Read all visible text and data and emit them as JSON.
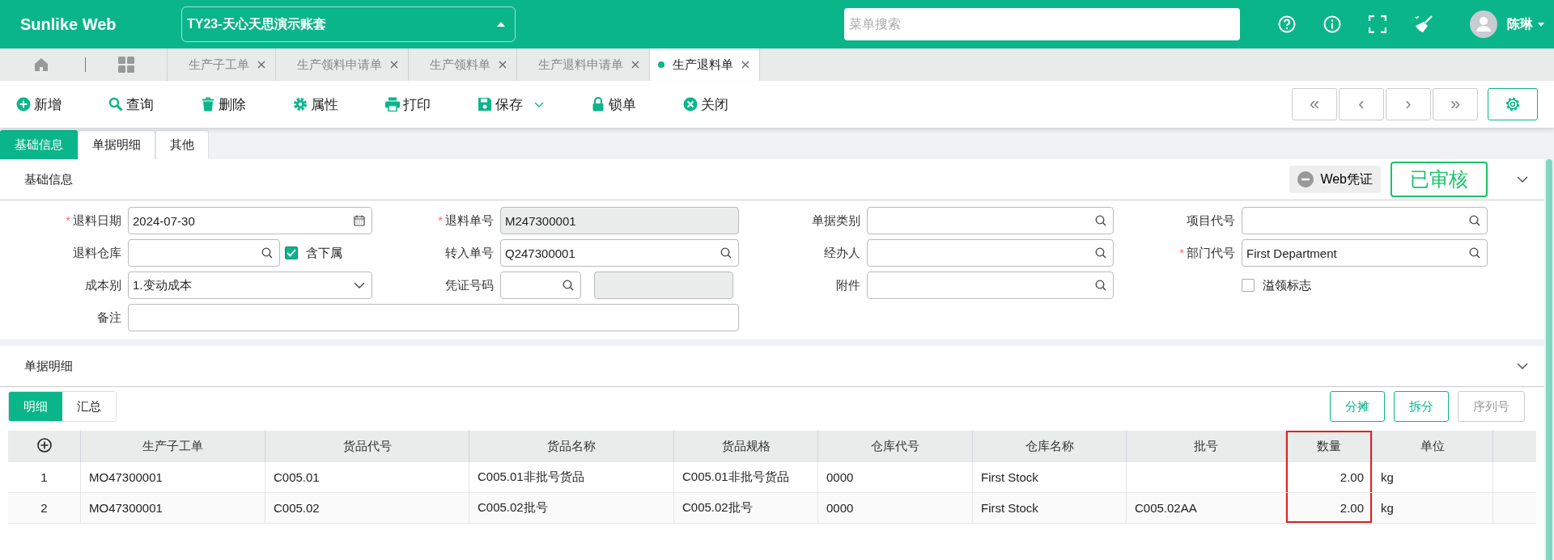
{
  "header": {
    "logo": "Sunlike Web",
    "account": "TY23-天心天思演示账套",
    "search": {
      "placeholder": "菜单搜索"
    },
    "user": "陈琳"
  },
  "tabs": [
    {
      "label": "生产子工单",
      "selected": false
    },
    {
      "label": "生产领料申请单",
      "selected": false
    },
    {
      "label": "生产领料单",
      "selected": false
    },
    {
      "label": "生产退料申请单",
      "selected": false
    },
    {
      "label": "生产退料单",
      "selected": true
    }
  ],
  "toolbar": [
    {
      "kind": "add",
      "label": "新增"
    },
    {
      "kind": "search",
      "label": "查询"
    },
    {
      "kind": "delete",
      "label": "删除"
    },
    {
      "kind": "gear",
      "label": "属性"
    },
    {
      "kind": "print",
      "label": "打印"
    },
    {
      "kind": "save",
      "label": "保存",
      "dropdown": true
    },
    {
      "kind": "lock",
      "label": "锁单"
    },
    {
      "kind": "close",
      "label": "关闭"
    }
  ],
  "nav_buttons": [
    "«",
    "‹",
    "›",
    "»"
  ],
  "form_tabs": [
    {
      "label": "基础信息",
      "selected": true
    },
    {
      "label": "单据明细",
      "selected": false
    },
    {
      "label": "其他",
      "selected": false
    }
  ],
  "basic_info": {
    "title": "基础信息",
    "voucher_button": "Web凭证",
    "status_stamp": "已审核",
    "expanded": true,
    "rows": [
      [
        {
          "mark": "*",
          "label": "退料日期",
          "kind": "date",
          "value": "2024-07-30"
        },
        {
          "mark": "*",
          "label": "退料单号",
          "kind": "readonly",
          "value": "M247300001"
        },
        {
          "label": "单据类别",
          "kind": "lookup"
        },
        {
          "label": "项目代号",
          "kind": "lookup"
        }
      ],
      [
        {
          "label": "退料仓库",
          "kind": "lookup",
          "addon": {
            "kind": "checkbox",
            "label": "含下属",
            "checked": true
          }
        },
        {
          "label": "转入单号",
          "kind": "lookup",
          "value": "Q247300001"
        },
        {
          "label": "经办人",
          "kind": "lookup"
        },
        {
          "mark": "*",
          "label": "部门代号",
          "kind": "lookup",
          "value": "First Department"
        }
      ],
      [
        {
          "label": "成本别",
          "kind": "select",
          "value": "1.变动成本"
        },
        {
          "label": "凭证号码",
          "kind": "lookup",
          "addon": {
            "kind": "readonly"
          }
        },
        {
          "label": "附件",
          "kind": "lookup"
        },
        {
          "kind": "checkbox",
          "text": "溢领标志",
          "checked": false
        }
      ],
      [
        {
          "label": "备注",
          "kind": "note"
        }
      ]
    ]
  },
  "detail": {
    "title": "单据明细",
    "expanded": true,
    "sub_tabs": [
      {
        "label": "明细",
        "selected": true
      },
      {
        "label": "汇总",
        "selected": false
      }
    ],
    "buttons": [
      {
        "label": "分摊",
        "disabled": false
      },
      {
        "label": "拆分",
        "disabled": false
      },
      {
        "label": "序列号",
        "disabled": true
      }
    ],
    "table": {
      "columns": [
        {
          "kind": "add",
          "highlighted": false
        },
        {
          "label": "生产子工单",
          "highlighted": false
        },
        {
          "label": "货品代号",
          "highlighted": false
        },
        {
          "label": "货品名称",
          "highlighted": false
        },
        {
          "label": "货品规格",
          "highlighted": false
        },
        {
          "label": "仓库代号",
          "highlighted": false
        },
        {
          "label": "仓库名称",
          "highlighted": false
        },
        {
          "label": "批号",
          "highlighted": false
        },
        {
          "label": "数量",
          "highlighted": true
        },
        {
          "label": "单位",
          "highlighted": false
        }
      ],
      "rows": [
        [
          "1",
          "MO47300001",
          "C005.01",
          "C005.01非批号货品",
          "C005.01非批号货品",
          "0000",
          "First Stock",
          null,
          "2.00",
          "kg"
        ],
        [
          "2",
          "MO47300001",
          "C005.02",
          "C005.02批号",
          "C005.02批号",
          "0000",
          "First Stock",
          "C005.02AA",
          "2.00",
          "kg"
        ]
      ]
    }
  }
}
